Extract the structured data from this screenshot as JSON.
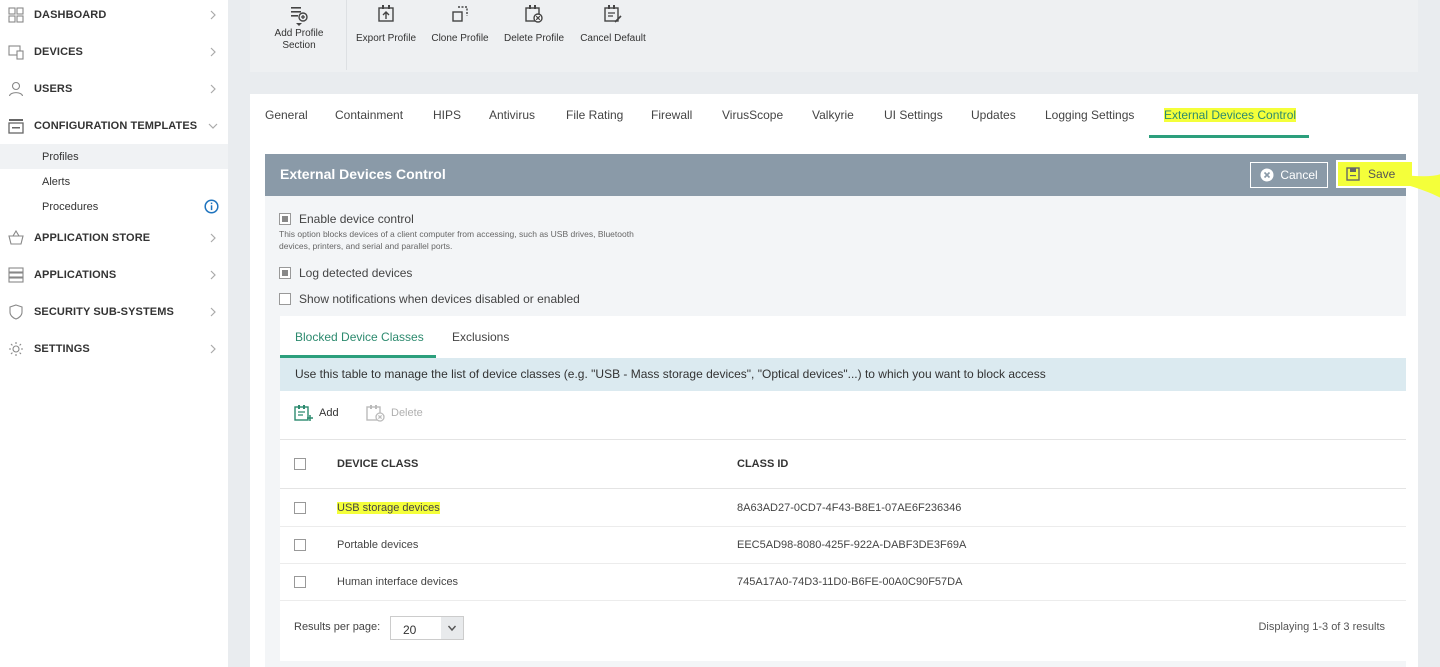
{
  "sidebar": {
    "items": [
      {
        "label": "DASHBOARD"
      },
      {
        "label": "DEVICES"
      },
      {
        "label": "USERS"
      },
      {
        "label": "CONFIGURATION TEMPLATES"
      },
      {
        "label": "APPLICATION STORE"
      },
      {
        "label": "APPLICATIONS"
      },
      {
        "label": "SECURITY SUB-SYSTEMS"
      },
      {
        "label": "SETTINGS"
      }
    ],
    "sub_items": [
      {
        "label": "Profiles"
      },
      {
        "label": "Alerts"
      },
      {
        "label": "Procedures"
      }
    ]
  },
  "toolbar": {
    "add_profile_line1": "Add Profile",
    "add_profile_line2": "Section",
    "export": "Export Profile",
    "clone": "Clone Profile",
    "delete": "Delete Profile",
    "cancel_default": "Cancel Default"
  },
  "tabs": [
    {
      "label": "General"
    },
    {
      "label": "Containment"
    },
    {
      "label": "HIPS"
    },
    {
      "label": "Antivirus"
    },
    {
      "label": "File Rating"
    },
    {
      "label": "Firewall"
    },
    {
      "label": "VirusScope"
    },
    {
      "label": "Valkyrie"
    },
    {
      "label": "UI Settings"
    },
    {
      "label": "Updates"
    },
    {
      "label": "Logging Settings"
    },
    {
      "label": "External Devices Control"
    }
  ],
  "section": {
    "title": "External Devices Control",
    "cancel_label": "Cancel",
    "save_label": "Save"
  },
  "options": {
    "enable_label": "Enable device control",
    "enable_help": "This option blocks devices of a client computer from accessing, such as USB drives, Bluetooth devices, printers, and serial and parallel ports.",
    "log_label": "Log detected devices",
    "notify_label": "Show notifications when devices disabled or enabled"
  },
  "inner_tabs": [
    {
      "label": "Blocked Device Classes"
    },
    {
      "label": "Exclusions"
    }
  ],
  "info_text": "Use this table to manage the list of device classes (e.g. \"USB - Mass storage devices\", \"Optical devices\"...) to which you want to block access",
  "actions": {
    "add": "Add",
    "delete": "Delete"
  },
  "table": {
    "headers": [
      "DEVICE CLASS",
      "CLASS ID"
    ],
    "rows": [
      {
        "device_class": "USB storage devices",
        "class_id": "8A63AD27-0CD7-4F43-B8E1-07AE6F236346"
      },
      {
        "device_class": "Portable devices",
        "class_id": "EEC5AD98-8080-425F-922A-DABF3DE3F69A"
      },
      {
        "device_class": "Human interface devices",
        "class_id": "745A17A0-74D3-11D0-B6FE-00A0C90F57DA"
      }
    ]
  },
  "footer": {
    "results_per_page_label": "Results per page:",
    "results_per_page_value": "20",
    "displaying": "Displaying 1-3 of 3 results"
  },
  "colors": {
    "accent": "#2c9f7c",
    "header_bg": "#8a9aa8",
    "highlight": "#f4ff3a",
    "info_bar": "#dbeaf0"
  }
}
